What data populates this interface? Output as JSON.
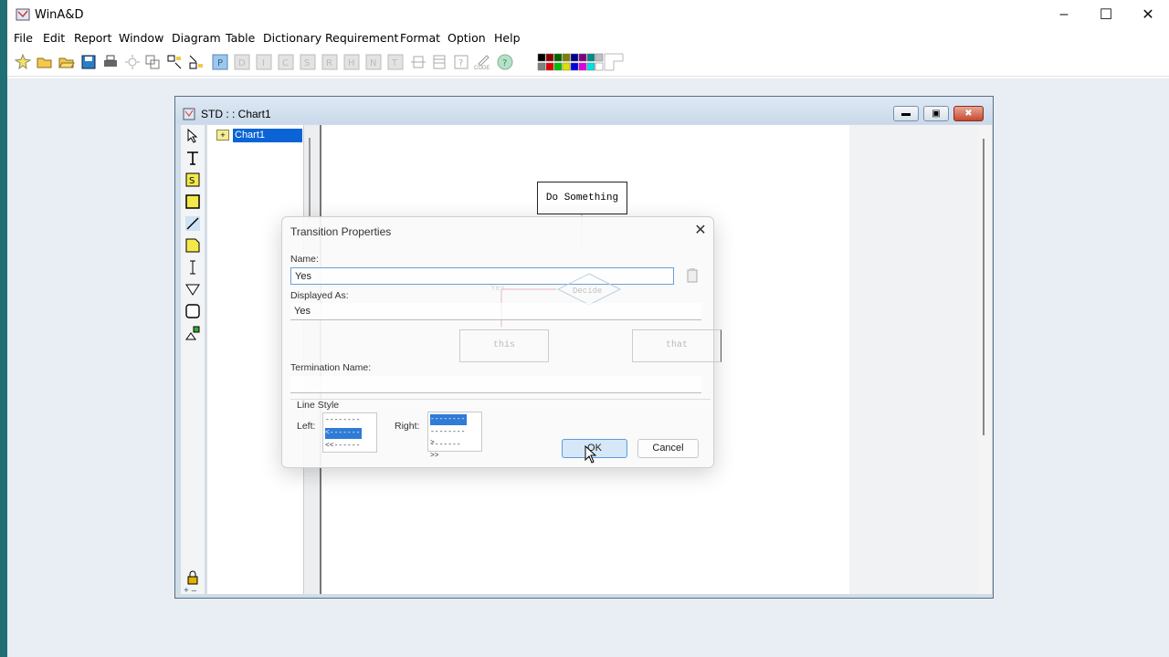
{
  "app": {
    "title": "WinA&D"
  },
  "menu": [
    "File",
    "Edit",
    "Report",
    "Window",
    "Diagram",
    "Table",
    "Dictionary",
    "Requirement",
    "Format",
    "Option",
    "Help"
  ],
  "toolbar": {
    "code_label": "CODE"
  },
  "child_window": {
    "title": "STD : : Chart1"
  },
  "tree": {
    "selected_item": "Chart1"
  },
  "diagram": {
    "state_top": "Do Something",
    "decision": "Decide",
    "transition_label": "Yes",
    "state_left": "this",
    "state_right": "that"
  },
  "dialog": {
    "title": "Transition Properties",
    "name_label": "Name:",
    "name_value": "Yes",
    "displayed_as_label": "Displayed As:",
    "displayed_as_value": "Yes",
    "termination_label": "Termination Name:",
    "termination_value": "",
    "line_style_label": "Line Style",
    "left_label": "Left:",
    "right_label": "Right:",
    "left_options": [
      "---------",
      "<--------",
      "<<------"
    ],
    "right_options": [
      "---------",
      "-------->",
      "------->>"
    ],
    "ok_label": "OK",
    "cancel_label": "Cancel"
  },
  "colors": {
    "accent": "#0a64d6",
    "desktop": "#1f6f74"
  }
}
